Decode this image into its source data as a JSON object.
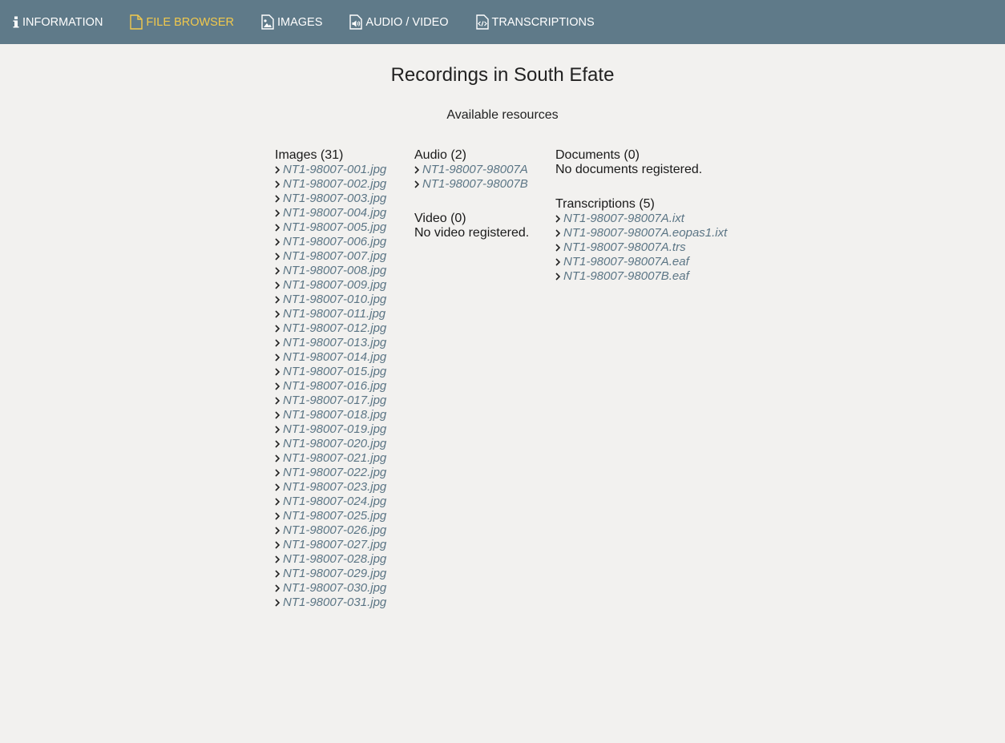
{
  "nav": {
    "items": [
      {
        "label": "INFORMATION",
        "icon": "info-icon",
        "active": false
      },
      {
        "label": "FILE BROWSER",
        "icon": "file-icon",
        "active": true
      },
      {
        "label": "IMAGES",
        "icon": "image-file-icon",
        "active": false
      },
      {
        "label": "AUDIO / VIDEO",
        "icon": "audio-file-icon",
        "active": false
      },
      {
        "label": "TRANSCRIPTIONS",
        "icon": "code-file-icon",
        "active": false
      }
    ],
    "active_color": "#f2c94c",
    "bar_color": "#5f7a89"
  },
  "page": {
    "title": "Recordings in South Efate",
    "subtitle": "Available resources"
  },
  "images": {
    "heading": "Images (31)",
    "files": [
      "NT1-98007-001.jpg",
      "NT1-98007-002.jpg",
      "NT1-98007-003.jpg",
      "NT1-98007-004.jpg",
      "NT1-98007-005.jpg",
      "NT1-98007-006.jpg",
      "NT1-98007-007.jpg",
      "NT1-98007-008.jpg",
      "NT1-98007-009.jpg",
      "NT1-98007-010.jpg",
      "NT1-98007-011.jpg",
      "NT1-98007-012.jpg",
      "NT1-98007-013.jpg",
      "NT1-98007-014.jpg",
      "NT1-98007-015.jpg",
      "NT1-98007-016.jpg",
      "NT1-98007-017.jpg",
      "NT1-98007-018.jpg",
      "NT1-98007-019.jpg",
      "NT1-98007-020.jpg",
      "NT1-98007-021.jpg",
      "NT1-98007-022.jpg",
      "NT1-98007-023.jpg",
      "NT1-98007-024.jpg",
      "NT1-98007-025.jpg",
      "NT1-98007-026.jpg",
      "NT1-98007-027.jpg",
      "NT1-98007-028.jpg",
      "NT1-98007-029.jpg",
      "NT1-98007-030.jpg",
      "NT1-98007-031.jpg"
    ]
  },
  "audio": {
    "heading": "Audio (2)",
    "files": [
      "NT1-98007-98007A",
      "NT1-98007-98007B"
    ]
  },
  "video": {
    "heading": "Video (0)",
    "empty": "No video registered."
  },
  "documents": {
    "heading": "Documents (0)",
    "empty": "No documents registered."
  },
  "transcriptions": {
    "heading": "Transcriptions (5)",
    "files": [
      "NT1-98007-98007A.ixt",
      "NT1-98007-98007A.eopas1.ixt",
      "NT1-98007-98007A.trs",
      "NT1-98007-98007A.eaf",
      "NT1-98007-98007B.eaf"
    ]
  },
  "link_color": "#5b7585"
}
